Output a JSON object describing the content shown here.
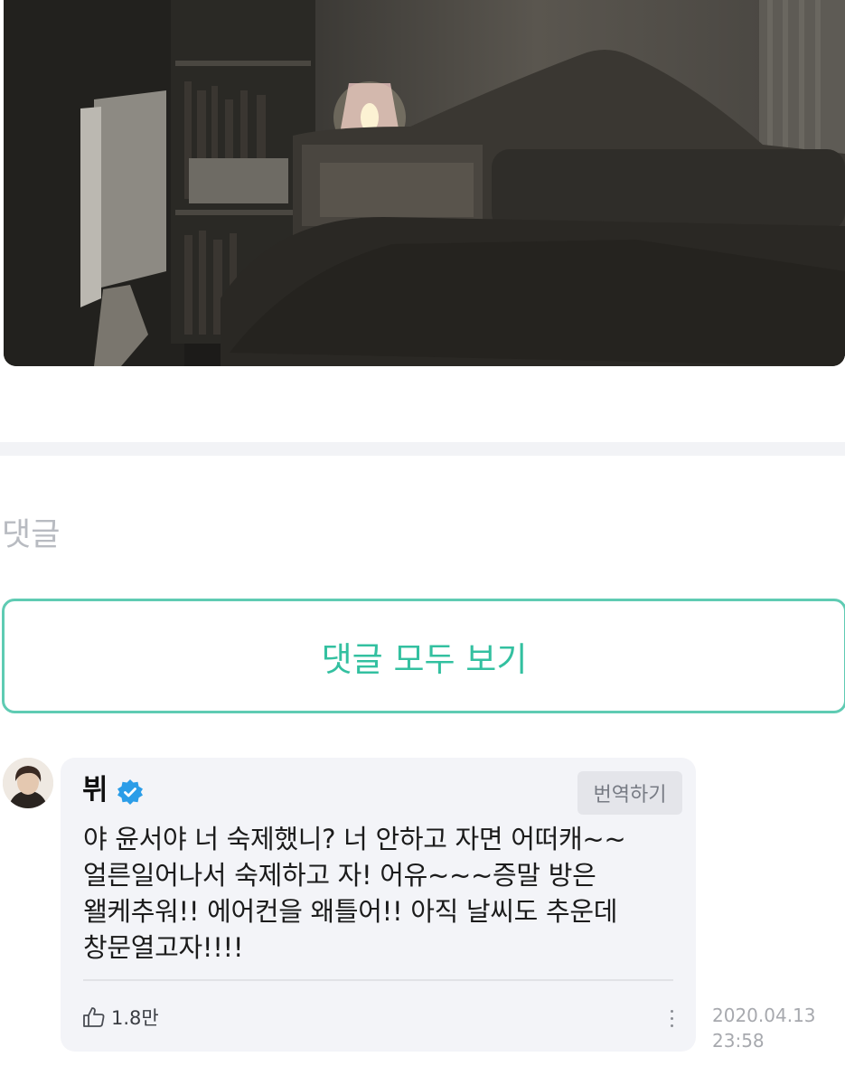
{
  "post_photo": {
    "alt_kind": "bedroom-night-photo"
  },
  "comments_section": {
    "title": "댓글",
    "view_all_label": "댓글 모두 보기"
  },
  "comment": {
    "author": "뷔",
    "verified_icon": "verified-badge-icon",
    "translate_label": "번역하기",
    "text": "야 윤서야 너 숙제했니? 너 안하고 자면 어떠캐~~\n얼른일어나서 숙제하고 자! 어유~~~증말 방은\n왤케추워!! 에어컨을 왜틀어!! 아직 날씨도 추운데\n창문열고자!!!!",
    "like_icon": "thumbs-up-icon",
    "like_count": "1.8만",
    "more_icon": "more-vertical-icon",
    "date": "2020.04.13",
    "time": "23:58"
  },
  "colors": {
    "accent": "#33c0a0",
    "verified": "#2b9de8",
    "bubble_bg": "#f3f4f8"
  }
}
